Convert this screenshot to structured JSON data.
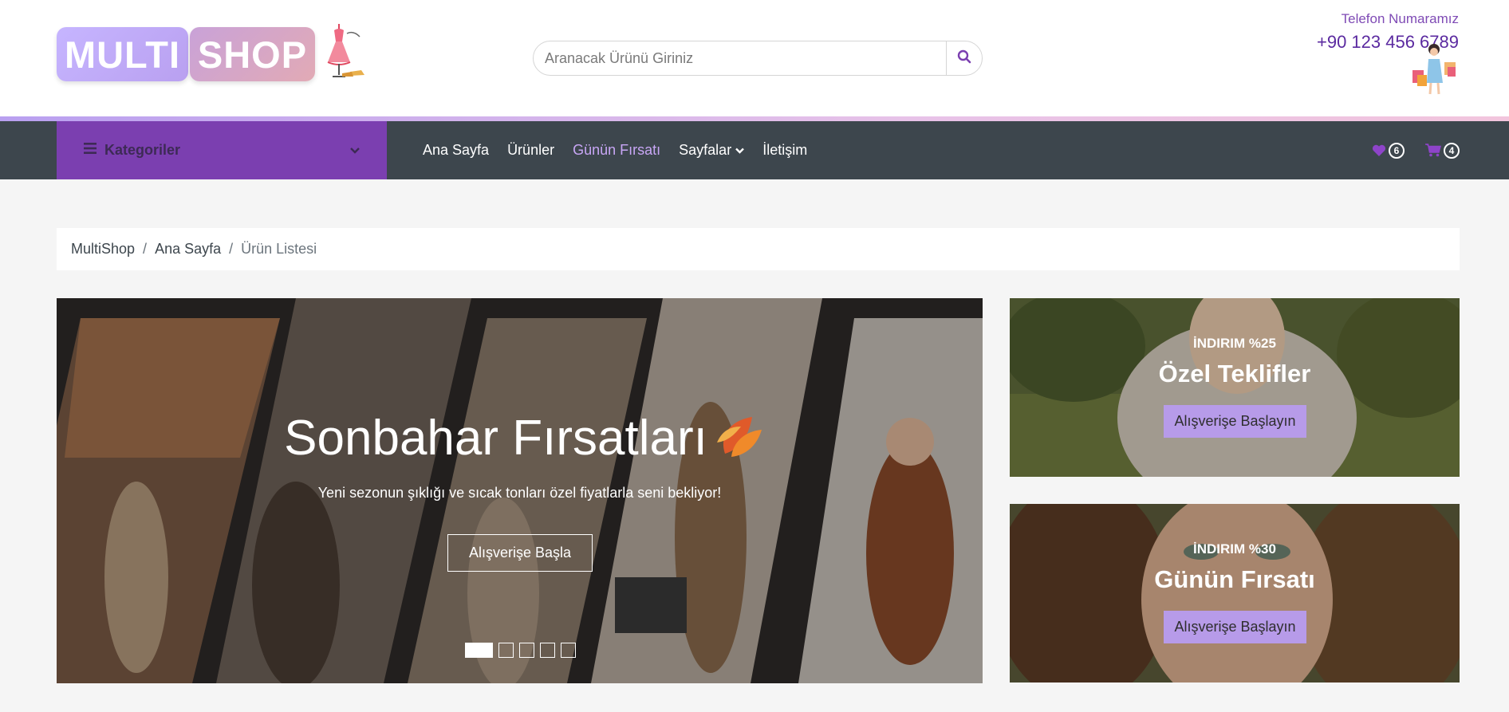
{
  "logo": {
    "part1": "MULTI",
    "part2": "SHOP"
  },
  "search": {
    "placeholder": "Aranacak Ürünü Giriniz",
    "icon": "search-icon"
  },
  "contact": {
    "label": "Telefon Numaramız",
    "phone": "+90 123 456 6789"
  },
  "nav": {
    "categories_label": "Kategoriler",
    "links": [
      {
        "label": "Ana Sayfa"
      },
      {
        "label": "Ürünler"
      },
      {
        "label": "Günün Fırsatı",
        "active": true
      },
      {
        "label": "Sayfalar",
        "dropdown": true
      },
      {
        "label": "İletişim"
      }
    ],
    "wishlist_count": "6",
    "cart_count": "4"
  },
  "breadcrumb": {
    "items": [
      "MultiShop",
      "Ana Sayfa",
      "Ürün Listesi"
    ],
    "separator": "/"
  },
  "hero": {
    "title": "Sonbahar Fırsatları",
    "subtitle": "Yeni sezonun şıklığı ve sıcak tonları özel fiyatlarla seni bekliyor!",
    "button": "Alışverişe Başla",
    "slides": 5,
    "active_slide": 1
  },
  "offers": [
    {
      "discount": "İNDIRIM %25",
      "title": "Özel Teklifler",
      "button": "Alışverişe Başlayın"
    },
    {
      "discount": "İNDIRIM %30",
      "title": "Günün Fırsatı",
      "button": "Alışverişe Başlayın"
    }
  ],
  "colors": {
    "brand_purple": "#7b3fb0",
    "nav_dark": "#3d464d",
    "accent_lavender": "#b79be9",
    "active_link": "#c8a6f5"
  }
}
